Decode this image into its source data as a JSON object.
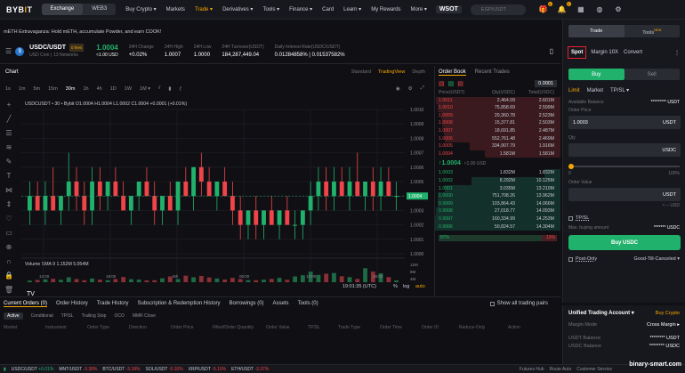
{
  "nav": {
    "logo": "BYBIT",
    "exchange": "Exchange",
    "web3": "WEB3",
    "items": [
      "Buy Crypto ▾",
      "Markets",
      "Trade ▾",
      "Derivatives ▾",
      "Tools ▾",
      "Finance ▾",
      "Card",
      "Learn ▾",
      "My Rewards",
      "More ▾"
    ],
    "wsot": "WSOT",
    "search_placeholder": "EGP/USDT",
    "badge1": "6",
    "badge2": "2"
  },
  "banner": "mETH Extravaganza: Hold mETH, accumulate Powder, and earn COOK!",
  "ticker": {
    "pair": "USDC/USDT",
    "fee": "0 fees",
    "coin_name": "USD Coin",
    "networks": "13 Networks",
    "price": "1.0004",
    "price_usd": "≈1.00 USD",
    "stats": [
      {
        "l": "24H Change",
        "v": "+0.02%"
      },
      {
        "l": "24H High",
        "v": "1.0007"
      },
      {
        "l": "24H Low",
        "v": "1.0000"
      },
      {
        "l": "24H Turnover(USDT)",
        "v": "184,287,449.04"
      },
      {
        "l": "Daily Interest Rate(USDC/USDT)",
        "v": "0.01284858% | 0.01537582%"
      }
    ]
  },
  "chart": {
    "title": "Chart",
    "views": [
      "Standard",
      "TradingView",
      "Depth"
    ],
    "timeframes": [
      "1s",
      "1m",
      "5m",
      "15m",
      "30m",
      "1h",
      "4h",
      "1D",
      "1W",
      "1M ▾"
    ],
    "ohlc": "USDCUSDT • 30 • Bybit  O1.0004  H1.0004  L1.0002  C1.0004  +0.0001 (+0.01%)",
    "vol_label": "Volume SMA 9  1.152M  5.054M",
    "time": "19:01:35 (UTC)",
    "pct": "%",
    "log": "log",
    "auto": "auto",
    "price_ticks": [
      "1.0010",
      "1.0009",
      "1.0008",
      "1.0007",
      "1.0006",
      "1.0005",
      "1.0004",
      "1.0003",
      "1.0002",
      "1.0001",
      "1.0000"
    ],
    "last_price": "1.0004",
    "vol_ticks": [
      "12M",
      "8M",
      "4M"
    ],
    "time_ticks": [
      "12:00",
      "18:00",
      "6th",
      "06:00",
      "12:00",
      "18:00"
    ]
  },
  "chart_data": {
    "type": "candlestick",
    "x_labels": [
      "12:00",
      "18:00",
      "6th",
      "06:00",
      "12:00",
      "18:00"
    ],
    "ylim": [
      1.0,
      1.001
    ],
    "candles": [
      [
        1.0003,
        1.0005,
        1.0002,
        1.0004
      ],
      [
        1.0004,
        1.0005,
        1.0003,
        1.0003
      ],
      [
        1.0003,
        1.0005,
        1.0002,
        1.0004
      ],
      [
        1.0004,
        1.0006,
        1.0003,
        1.0003
      ],
      [
        1.0003,
        1.0004,
        1.0002,
        1.0004
      ],
      [
        1.0004,
        1.0007,
        1.0003,
        1.0005
      ],
      [
        1.0005,
        1.0006,
        1.0003,
        1.0004
      ],
      [
        1.0004,
        1.0005,
        1.0002,
        1.0003
      ],
      [
        1.0003,
        1.0006,
        1.0002,
        1.0005
      ],
      [
        1.0005,
        1.0006,
        1.0003,
        1.0004
      ],
      [
        1.0004,
        1.0005,
        1.0003,
        1.0005
      ],
      [
        1.0005,
        1.0006,
        1.0004,
        1.0004
      ],
      [
        1.0004,
        1.0005,
        1.0003,
        1.0003
      ],
      [
        1.0003,
        1.0004,
        1.0002,
        1.0004
      ],
      [
        1.0004,
        1.0005,
        1.0003,
        1.0005
      ],
      [
        1.0005,
        1.0006,
        1.0004,
        1.0004
      ],
      [
        1.0004,
        1.0005,
        1.0002,
        1.0003
      ],
      [
        1.0003,
        1.0004,
        1.0002,
        1.0004
      ],
      [
        1.0004,
        1.0005,
        1.0003,
        1.0003
      ],
      [
        1.0003,
        1.0005,
        1.0002,
        1.0005
      ],
      [
        1.0005,
        1.0006,
        1.0004,
        1.0004
      ],
      [
        1.0004,
        1.0006,
        1.0003,
        1.0006
      ],
      [
        1.0006,
        1.0007,
        1.0004,
        1.0005
      ],
      [
        1.0005,
        1.0006,
        1.0004,
        1.0004
      ],
      [
        1.0004,
        1.0005,
        1.0003,
        1.0005
      ],
      [
        1.0005,
        1.0006,
        1.0004,
        1.0004
      ],
      [
        1.0004,
        1.0005,
        1.0002,
        1.0003
      ],
      [
        1.0003,
        1.0004,
        1.0001,
        1.0002
      ],
      [
        1.0002,
        1.0003,
        1.0001,
        1.0003
      ],
      [
        1.0003,
        1.0004,
        1.0001,
        1.0002
      ],
      [
        1.0002,
        1.0003,
        1.0001,
        1.0003
      ],
      [
        1.0003,
        1.0004,
        1.0002,
        1.0002
      ],
      [
        1.0002,
        1.0003,
        1.0001,
        1.0003
      ],
      [
        1.0003,
        1.0004,
        1.0002,
        1.0002
      ],
      [
        1.0002,
        1.0003,
        1.0001,
        1.0002
      ],
      [
        1.0002,
        1.0003,
        1.0001,
        1.0003
      ],
      [
        1.0003,
        1.0005,
        1.0002,
        1.0004
      ],
      [
        1.0004,
        1.0006,
        1.0003,
        1.0005
      ],
      [
        1.0005,
        1.0006,
        1.0003,
        1.0004
      ],
      [
        1.0004,
        1.0006,
        1.0003,
        1.0005
      ],
      [
        1.0005,
        1.0006,
        1.0004,
        1.0004
      ],
      [
        1.0004,
        1.0006,
        1.0003,
        1.0005
      ],
      [
        1.0005,
        1.0007,
        1.0004,
        1.0004
      ],
      [
        1.0004,
        1.0005,
        1.0003,
        1.0005
      ],
      [
        1.0005,
        1.0006,
        1.0003,
        1.0004
      ],
      [
        1.0004,
        1.0006,
        1.0003,
        1.0005
      ],
      [
        1.0005,
        1.0006,
        1.0004,
        1.0004
      ],
      [
        1.0004,
        1.0005,
        1.0003,
        1.0004
      ]
    ],
    "volume": [
      1.1,
      1.5,
      1.9,
      2.3,
      1.6,
      3.3,
      2.1,
      1.3,
      2.5,
      1.7,
      1.3,
      2.1,
      3.5,
      2.0,
      1.7,
      1.2,
      1.3,
      2.6,
      3.9,
      2.1,
      4.4,
      3.3,
      4.2,
      3.2,
      2.5,
      1.8,
      2.9,
      2.1,
      1.4,
      1.3,
      1.7,
      2.2,
      2.9,
      1.6,
      3.9,
      4.7,
      7.1,
      4.9,
      5.7,
      6.2,
      4.0,
      3.4,
      2.2,
      9.4,
      7.1,
      6.0,
      3.4,
      1.2
    ]
  },
  "orderbook": {
    "tabs": [
      "Order Book",
      "Recent Trades"
    ],
    "precision": "0.0001",
    "headers": [
      "Price(USDT)",
      "Qty(USDC)",
      "Total(USDC)"
    ],
    "asks": [
      [
        "1.0011",
        "2,464.09",
        "2.601M"
      ],
      [
        "1.0010",
        "75,858.69",
        "2.599M"
      ],
      [
        "1.0009",
        "20,360.78",
        "2.523M"
      ],
      [
        "1.0008",
        "15,377.81",
        "2.503M"
      ],
      [
        "1.0007",
        "18,691.85",
        "2.487M"
      ],
      [
        "1.0006",
        "552,761.48",
        "2.469M"
      ],
      [
        "1.0005",
        "334,907.79",
        "1.916M"
      ],
      [
        "1.0004",
        "1.581M",
        "1.581M"
      ]
    ],
    "asks_depth": [
      0.99,
      0.98,
      0.95,
      0.94,
      0.93,
      0.92,
      0.72,
      0.6
    ],
    "mid": "↑1.0004",
    "mid_usd": "≈1.00 USD",
    "bids": [
      [
        "1.0003",
        "1.832M",
        "1.832M"
      ],
      [
        "1.0002",
        "8.292M",
        "10.125M"
      ],
      [
        "1.0001",
        "3.035M",
        "13.210M"
      ],
      [
        "1.0000",
        "751,708.26",
        "13.962M"
      ],
      [
        "0.9999",
        "103,864.43",
        "14.066M"
      ],
      [
        "0.9998",
        "27,018.77",
        "14.093M"
      ],
      [
        "0.9997",
        "160,334.99",
        "14.253M"
      ],
      [
        "0.9996",
        "50,824.57",
        "14.304M"
      ]
    ],
    "bids_depth": [
      0.13,
      0.71,
      0.92,
      0.98,
      0.98,
      0.99,
      1.0,
      1.0
    ],
    "buy_pct": "87%",
    "sell_pct": "13%"
  },
  "trade": {
    "top_tabs": [
      "Trade",
      "Tools"
    ],
    "new": "NEW",
    "modes": [
      "Spot",
      "Margin 10X",
      "Convert"
    ],
    "buy": "Buy",
    "sell": "Sell",
    "order_types": [
      "Limit",
      "Market",
      "TP/SL ▾"
    ],
    "avail_label": "Available Balance",
    "avail_value": "********* USDT",
    "price_label": "Order Price",
    "price_value": "1.0003",
    "price_unit": "USDT",
    "qty_label": "Qty",
    "qty_unit": "USDC",
    "slider_min": "0",
    "slider_max": "100%",
    "value_label": "Order Value",
    "value_unit": "USDT",
    "value_approx": "≈ -- USD",
    "tpsl": "TP/SL",
    "max_label": "Max. buying amount",
    "max_value": "******* USDC",
    "buy_btn": "Buy USDC",
    "postonly": "Post-Only",
    "gtc": "Good-Till-Canceled ▾"
  },
  "uta": {
    "title": "Unified Trading Account ▾",
    "buy_crypto": "Buy Crypto",
    "margin_mode_label": "Margin Mode",
    "margin_mode": "Cross Margin ▸",
    "rows": [
      {
        "l": "USDT Balance",
        "v": "******** USDT"
      },
      {
        "l": "USDC Balance",
        "v": "******** USDC"
      }
    ]
  },
  "bottom": {
    "tabs": [
      "Current Orders (0)",
      "Order History",
      "Trade History",
      "Subscription & Redemption History",
      "Borrowings (0)",
      "Assets",
      "Tools (0)"
    ],
    "show_all": "Show all trading pairs",
    "subtabs": [
      "Active",
      "Conditional",
      "TP/SL",
      "Trailing Stop",
      "OCO",
      "MMR Close"
    ],
    "cols": [
      "Market",
      "Instrument",
      "Order Type",
      "Direction",
      "Order Price",
      "Filled/Order Quantity",
      "Order Value",
      "TP/SL",
      "Trade Type",
      "Order Time",
      "Order ID",
      "Reduce-Only",
      "Action"
    ]
  },
  "footer": {
    "items": [
      {
        "p": "USDC/USDT",
        "c": "+0.01%"
      },
      {
        "p": "MNT/USDT",
        "c": "-3.38%"
      },
      {
        "p": "BTC/USDT",
        "c": "-3.18%"
      },
      {
        "p": "SOL/USDT",
        "c": "-5.10%"
      },
      {
        "p": "XRP/USDT",
        "c": "-5.10%"
      },
      {
        "p": "ETH/USDT",
        "c": "-3.37%"
      }
    ],
    "right": [
      "Futures Hub",
      "Route Auto",
      "Customer Service"
    ],
    "watermark": "binary-smart.com"
  },
  "colors": {
    "up": "#20b26c",
    "down": "#ef454a",
    "accent": "#f7a600",
    "highlight": "#e5222d"
  }
}
